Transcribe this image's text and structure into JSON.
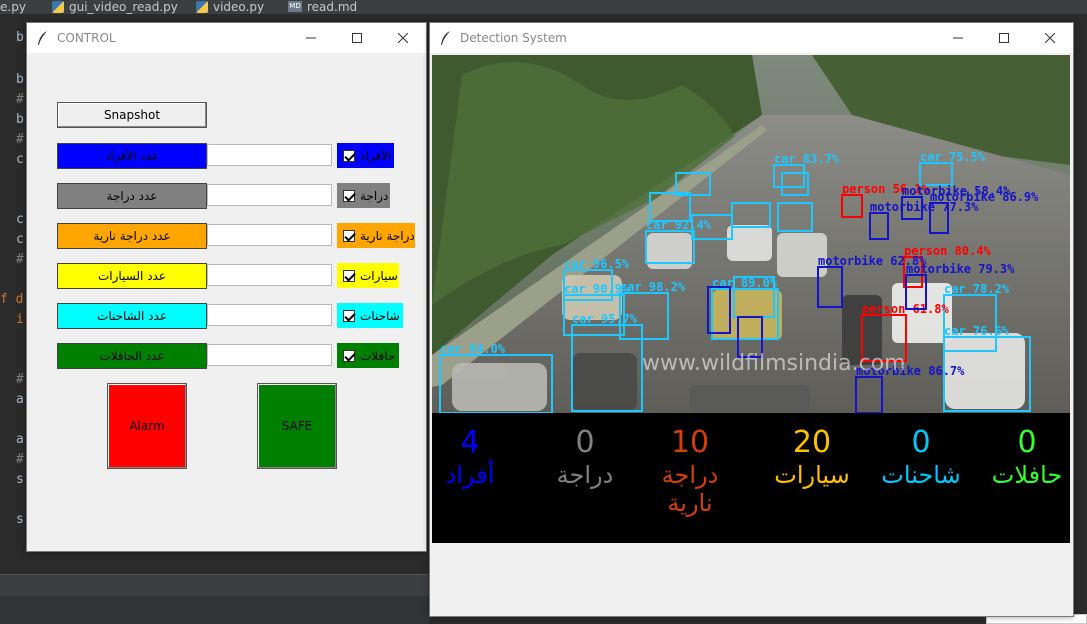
{
  "ide": {
    "tabs": [
      "e.py",
      "gui_video_read.py",
      "video.py",
      "read.md"
    ],
    "gutter": [
      "b",
      "b",
      "#",
      "b",
      "#",
      "c",
      "c",
      "c",
      "#",
      "f d",
      "i",
      "#",
      "a",
      "a",
      "#",
      "s",
      "s"
    ]
  },
  "control": {
    "title": "CONTROL",
    "snapshot_label": "Snapshot",
    "rows": [
      {
        "label": "عدد الأفراد",
        "check": "الأفراد",
        "color": "#0000ff",
        "value": ""
      },
      {
        "label": "عدد دراجة",
        "check": "دراجة",
        "color": "#808080",
        "value": ""
      },
      {
        "label": "عدد دراجة نارية",
        "check": "دراجة نارية",
        "color": "#ffa500",
        "value": ""
      },
      {
        "label": "عدد السيارات",
        "check": "سيارات",
        "color": "#ffff00",
        "value": ""
      },
      {
        "label": "عدد الشاحنات",
        "check": "شاحنات",
        "color": "#00ffff",
        "value": ""
      },
      {
        "label": "عدد الحافلات",
        "check": "حافلات",
        "color": "#008000",
        "value": ""
      }
    ],
    "alarm_label": "Alarm",
    "safe_label": "SAFE",
    "alarm_color": "#ff0000",
    "safe_color": "#008000"
  },
  "detection": {
    "title": "Detection System",
    "watermark": "www.wildfilmsindia.com",
    "boxes": [
      {
        "label": "car 94.0%",
        "cls": "car"
      },
      {
        "label": "car 90.9%",
        "cls": "car"
      },
      {
        "label": "car 95.7%",
        "cls": "car"
      },
      {
        "label": "car 96.5%",
        "cls": "car"
      },
      {
        "label": "car 92.4%",
        "cls": "car"
      },
      {
        "label": "car 98.2%",
        "cls": "car"
      },
      {
        "label": "car 89.0%",
        "cls": "car"
      },
      {
        "label": "car 83.7%",
        "cls": "car"
      },
      {
        "label": "car 75.5%",
        "cls": "car"
      },
      {
        "label": "car 78.2%",
        "cls": "car"
      },
      {
        "label": "car 76.6%",
        "cls": "car"
      },
      {
        "label": "person 56.1%",
        "cls": "person"
      },
      {
        "label": "person 80.4%",
        "cls": "person"
      },
      {
        "label": "person 61.8%",
        "cls": "person"
      },
      {
        "label": "motorbike 58.4%",
        "cls": "motorbike"
      },
      {
        "label": "motorbike 86.9%",
        "cls": "motorbike"
      },
      {
        "label": "motorbike 77.3%",
        "cls": "motorbike"
      },
      {
        "label": "motorbike 79.3%",
        "cls": "motorbike"
      },
      {
        "label": "motorbike 86.7%",
        "cls": "motorbike"
      },
      {
        "label": "motorbike 62.8%",
        "cls": "motorbike"
      }
    ],
    "stats": [
      {
        "num": "4",
        "label": "أفراد",
        "color": "#0000ff"
      },
      {
        "num": "0",
        "label": "دراجة",
        "color": "#808080"
      },
      {
        "num": "10",
        "label": "دراجة نارية",
        "color": "#d2400a"
      },
      {
        "num": "20",
        "label": "سيارات",
        "color": "#ffc000"
      },
      {
        "num": "0",
        "label": "شاحنات",
        "color": "#00c8ff"
      },
      {
        "num": "0",
        "label": "حافلات",
        "color": "#33ff33"
      }
    ]
  }
}
